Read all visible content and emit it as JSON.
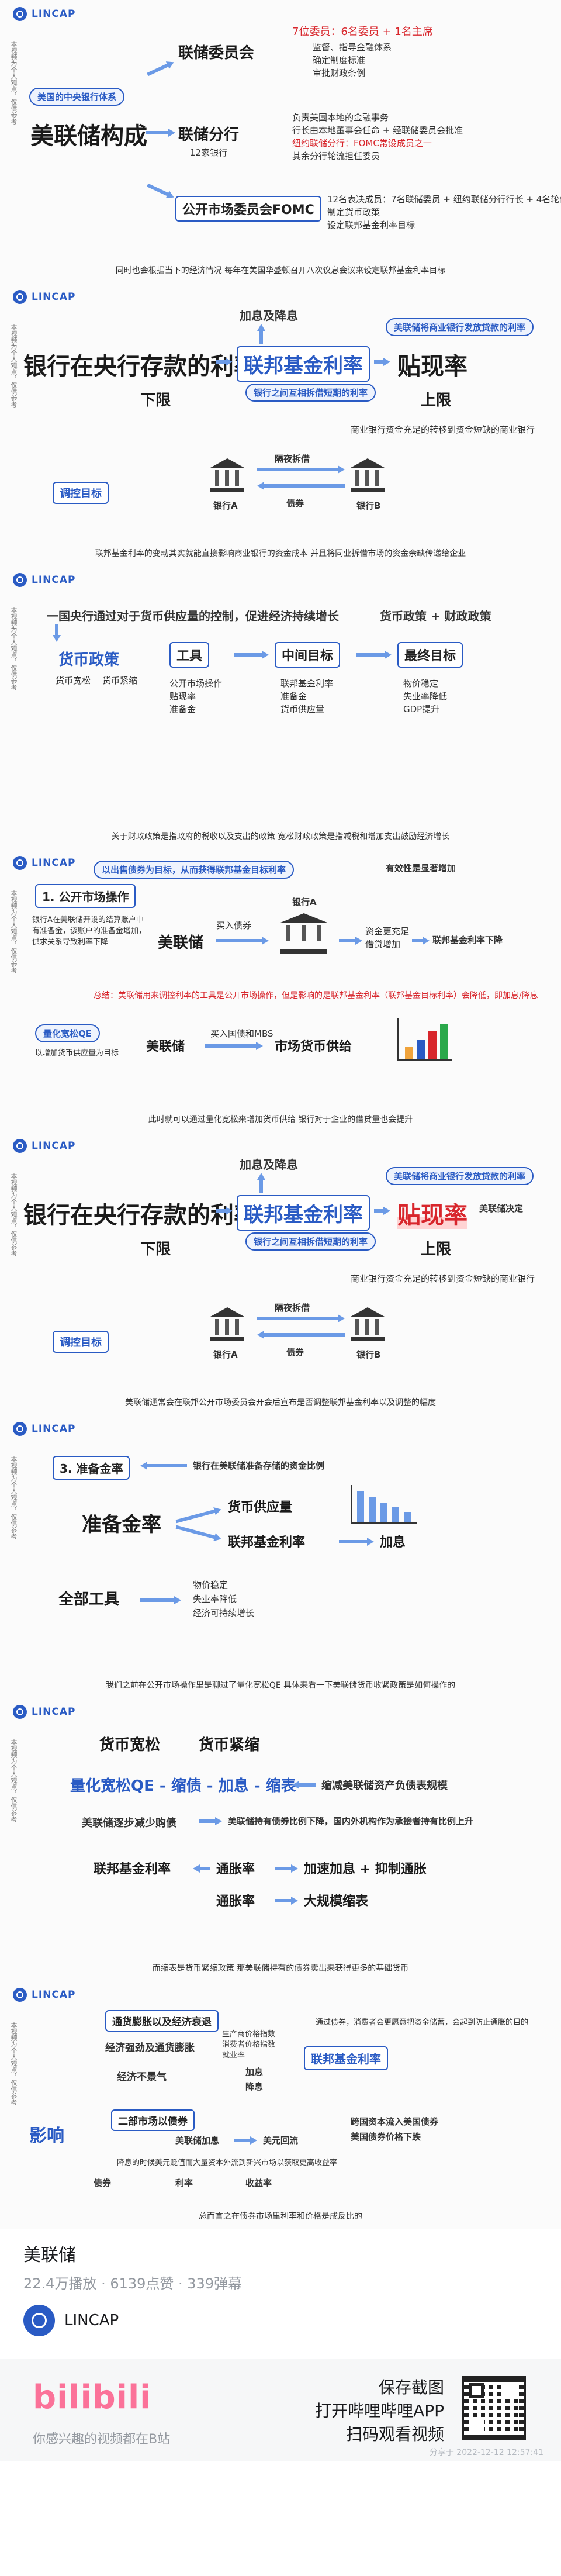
{
  "brand": {
    "logo_text": "LINCAP",
    "watermark": "LINCAP"
  },
  "side_note": "本视频为个人观点，仅供参考",
  "panels": [
    {
      "caption": "同时也会根据当下的经济情况 每年在美国华盛顿召开八次议息会议来设定联邦基金利率目标",
      "title": "美联储构成",
      "tag": "美国的中央银行体系",
      "branch1": "联储委员会",
      "branch1_notes": [
        "7位委员：6名委员 + 1名主席",
        "监督、指导金融体系",
        "确定制度标准",
        "审批财政条例"
      ],
      "branch2": "联储分行",
      "branch2_sub": "12家银行",
      "branch2_notes": [
        "负责美国本地的金融事务",
        "行长由本地董事会任命 + 经联储委员会批准",
        "纽约联储分行：FOMC常设成员之一",
        "其余分行轮流担任委员"
      ],
      "branch3": "公开市场委员会FOMC",
      "branch3_notes": [
        "12名表决成员：7名联储委员 + 纽约联储分行行长 + 4名轮值",
        "制定货币政策",
        "设定联邦基金利率目标"
      ]
    },
    {
      "caption": "联邦基金利率的变动其实就能直接影响商业银行的资金成本 并且将同业拆借市场的资金余缺传递给企业",
      "rate_label": "银行在央行存款的利率",
      "mid_label": "联邦基金利率",
      "right_label": "贴现率",
      "lower": "下限",
      "upper": "上限",
      "top_label": "加息及降息",
      "note_right": "美联储将商业银行发放贷款的利率",
      "note_mid": "银行之间互相拆借短期的利率",
      "bank_a": "银行A",
      "bank_b": "银行B",
      "bond": "债券",
      "target": "调控目标",
      "overnight": "隔夜拆借",
      "side_explain": "商业银行资金充足的转移到资金短缺的商业银行"
    },
    {
      "caption": "关于财政政策是指政府的税收以及支出的政策 宽松财政政策是指减税和增加支出鼓励经济增长",
      "headline": "一国央行通过对于货币供应量的控制，促进经济持续增长",
      "fiscal": "货币政策",
      "fiscal2": "货币政策 + 财政政策",
      "loose": "货币宽松",
      "tight": "货币紧缩",
      "tool": "工具",
      "mid_target": "中间目标",
      "final": "最终目标",
      "tools": [
        "公开市场操作",
        "贴现率",
        "准备金"
      ],
      "mids": [
        "联邦基金利率",
        "准备金",
        "货币供应量"
      ],
      "finals": [
        "物价稳定",
        "失业率降低",
        "GDP提升"
      ]
    },
    {
      "caption": "此时就可以通过量化宽松来增加货币供给 银行对于企业的借贷量也会提升",
      "banner": "以出售债券为目标，从而获得联邦基金目标利率",
      "step": "1. 公开市场操作",
      "note_left": "银行A在美联储开设的结算账户中有准备金，该账户的准备金增加，供求关系导致利率下降",
      "actor": "美联储",
      "buy": "买入债券",
      "bank": "银行A",
      "more": "资金更充足",
      "lend": "借贷增加",
      "rate_down": "联邦基金利率下降",
      "effect": "有效性是显著增加",
      "qe": "量化宽松QE",
      "qe_note": "以增加货币供应量为目标",
      "qe_buy": "买入国债和MBS",
      "qe_result": "市场货币供给",
      "summary": "总结：美联储用来调控利率的工具是公开市场操作，但是影响的是联邦基金利率（联邦基金目标利率）会降低，即加息/降息"
    },
    {
      "caption": "美联储通常会在联邦公开市场委员会开会后宣布是否调整联邦基金利率以及调整的幅度",
      "rate_label": "银行在央行存款的利率",
      "mid_label": "联邦基金利率",
      "right_label": "贴现率",
      "lower": "下限",
      "upper": "上限",
      "top_label": "加息及降息",
      "note_right": "美联储将商业银行发放贷款的利率",
      "note_mid": "银行之间互相拆借短期的利率",
      "bank_a": "银行A",
      "bank_b": "银行B",
      "bond": "债券",
      "target": "调控目标",
      "overnight": "隔夜拆借",
      "side_note": "美联储决定",
      "side_explain": "商业银行资金充足的转移到资金短缺的商业银行"
    },
    {
      "caption": "我们之前在公开市场操作里是聊过了量化宽松QE 具体来看一下美联储货币收紧政策是如何操作的",
      "step": "3. 准备金率",
      "step_note": "银行在美联储准备存储的资金比例",
      "center": "准备金率",
      "arrows": [
        "货币供应量",
        "联邦基金利率"
      ],
      "rate_up": "加息",
      "tools_title": "全部工具",
      "tools": [
        "物价稳定",
        "失业率降低",
        "经济可持续增长"
      ]
    },
    {
      "caption": "而缩表是货币紧缩政策 那美联储持有的债券卖出来获得更多的基础货币",
      "loose": "货币宽松",
      "tight": "货币紧缩",
      "chain": "量化宽松QE - 缩债 - 加息 - 缩表",
      "right_note": "缩减美联储资产负债表规模",
      "mid_note": "美联储逐步减少购债",
      "mid_note2": "美联储持有债券比例下降，国内外机构作为承接者持有比例上升",
      "fed": "联邦基金利率",
      "l1": "通胀率",
      "r1": "加速加息 + 抑制通胀",
      "l2": "通胀率",
      "r2": "大规模缩表"
    },
    {
      "caption": "总而言之在债券市场里利率和价格是成反比的",
      "box1": "通货膨胀以及经济衰退",
      "box2": "二部市场以债券",
      "line1": "经济强劲及通货膨胀",
      "line2": "经济不景气",
      "raise": "加息",
      "cut": "降息",
      "fed": "联邦基金利率",
      "effect": "影响",
      "fed2": "美联储加息",
      "usd": "美元回流",
      "price": "债券",
      "rate": "利率",
      "yield": "收益率",
      "notes": [
        "生产商价格指数",
        "消费者价格指数",
        "就业率"
      ],
      "right_top": "通过债券，消费者会更愿意把资金储蓄，会起到防止通胀的目的",
      "right_bottom": "跨国资本流入美国债券",
      "right_bottom2": "美国债券价格下跌",
      "bottom_note": "降息的时候美元贬值而大量资本外流到新兴市场以获取更高收益率"
    }
  ],
  "video": {
    "title": "美联储",
    "stats": "22.4万播放 · 6139点赞 · 339弹幕",
    "uploader": "LINCAP"
  },
  "promo": {
    "logo": "bilibili",
    "tagline": "你感兴趣的视频都在B站",
    "cta_line1": "保存截图",
    "cta_line2": "打开哔哩哔哩APP",
    "cta_line3": "扫码观看视频",
    "timestamp": "分享于 2022-12-12 12:57:41"
  }
}
